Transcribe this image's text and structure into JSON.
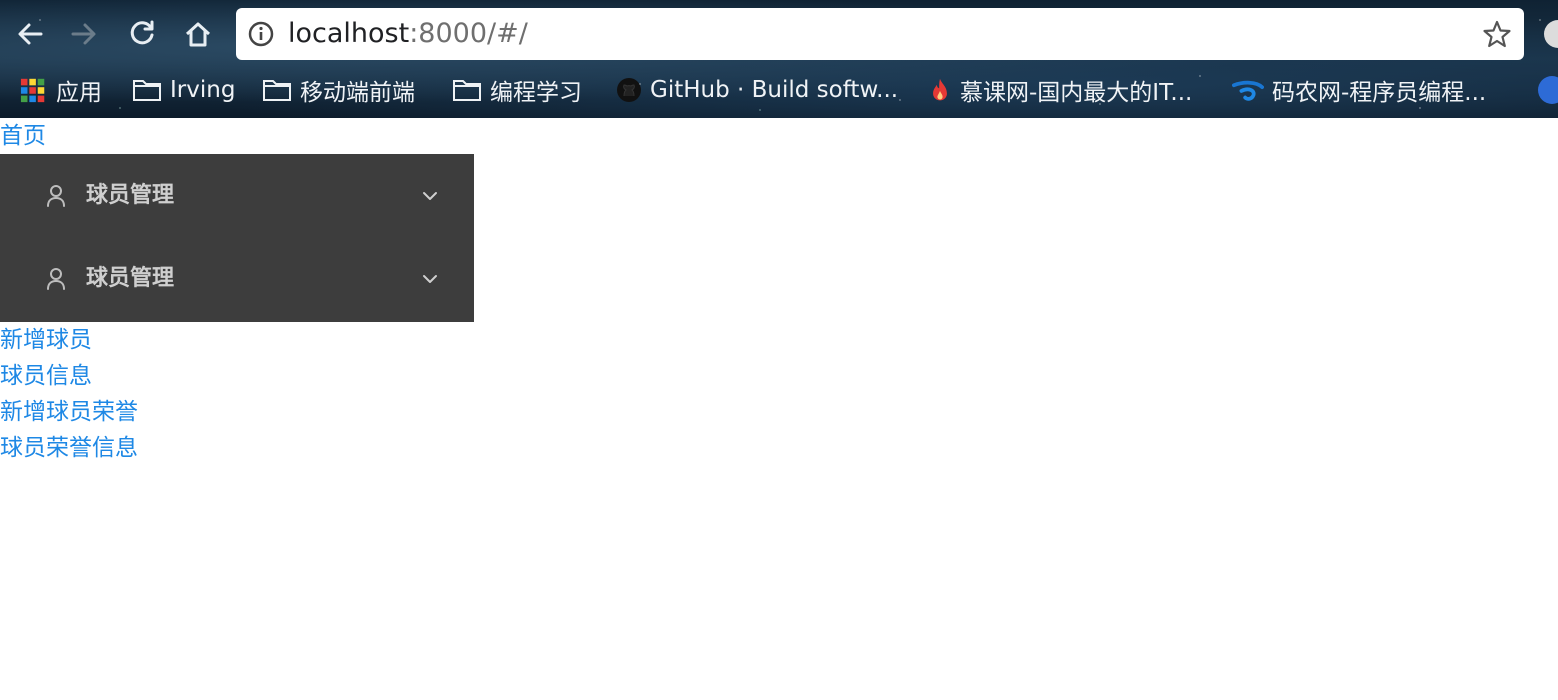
{
  "browser": {
    "url_host": "localhost",
    "url_rest": ":8000/#/",
    "bookmarks": [
      {
        "label": "应用",
        "icon": "apps-grid-icon"
      },
      {
        "label": "Irving",
        "icon": "folder-icon"
      },
      {
        "label": "移动端前端",
        "icon": "folder-icon"
      },
      {
        "label": "编程学习",
        "icon": "folder-icon"
      },
      {
        "label": "GitHub · Build softw...",
        "icon": "github-icon"
      },
      {
        "label": "慕课网-国内最大的IT...",
        "icon": "flame-icon"
      },
      {
        "label": "码农网-程序员编程...",
        "icon": "codeceo-icon"
      }
    ]
  },
  "page": {
    "home_link": "首页",
    "menu": [
      {
        "label": "球员管理"
      },
      {
        "label": "球员管理"
      }
    ],
    "links": [
      {
        "label": "新增球员"
      },
      {
        "label": "球员信息"
      },
      {
        "label": "新增球员荣誉"
      },
      {
        "label": "球员荣誉信息"
      }
    ]
  },
  "colors": {
    "link": "#1e88e5",
    "menu_bg": "#3d3d3d",
    "menu_text": "#cfcfcf"
  }
}
